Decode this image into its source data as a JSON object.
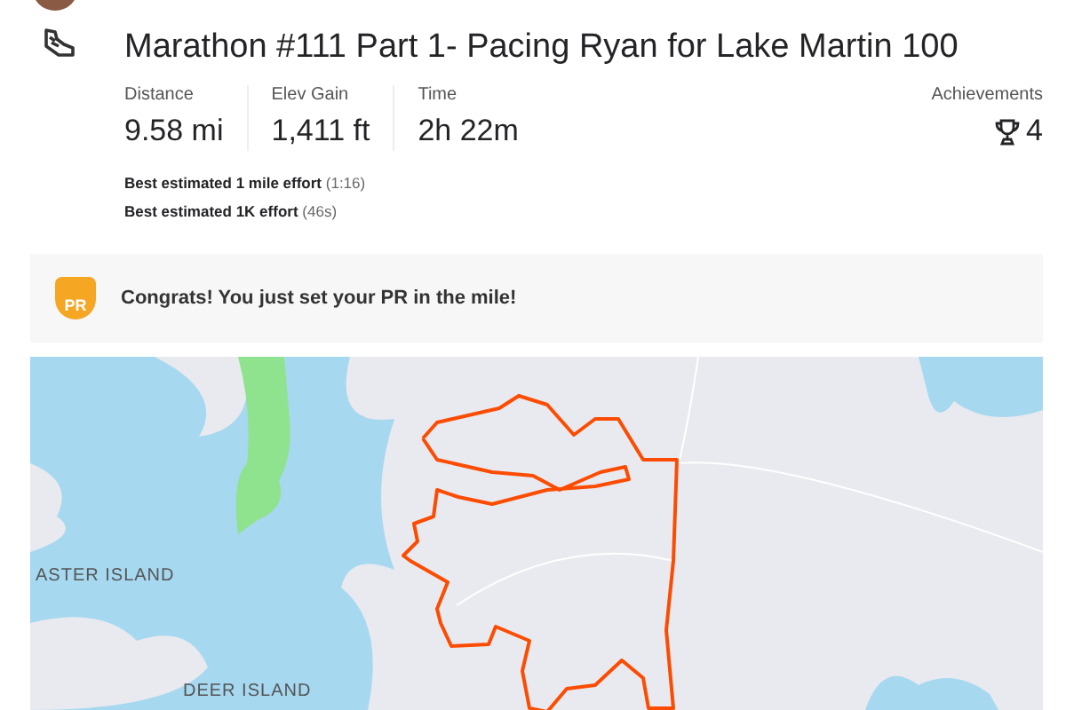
{
  "activity": {
    "title": "Marathon #111 Part 1- Pacing Ryan for Lake Martin 100",
    "stats": [
      {
        "label": "Distance",
        "value": "9.58 mi"
      },
      {
        "label": "Elev Gain",
        "value": "1,411 ft"
      },
      {
        "label": "Time",
        "value": "2h 22m"
      }
    ],
    "achievements": {
      "label": "Achievements",
      "value": "4"
    },
    "best_efforts": [
      {
        "name": "Best estimated 1 mile effort",
        "time": "(1:16)"
      },
      {
        "name": "Best estimated 1K effort",
        "time": "(46s)"
      }
    ]
  },
  "banner": {
    "badge": "PR",
    "text": "Congrats! You just set your PR in the mile!"
  },
  "map": {
    "labels": [
      "ASTER ISLAND",
      "DEER ISLAND"
    ]
  }
}
